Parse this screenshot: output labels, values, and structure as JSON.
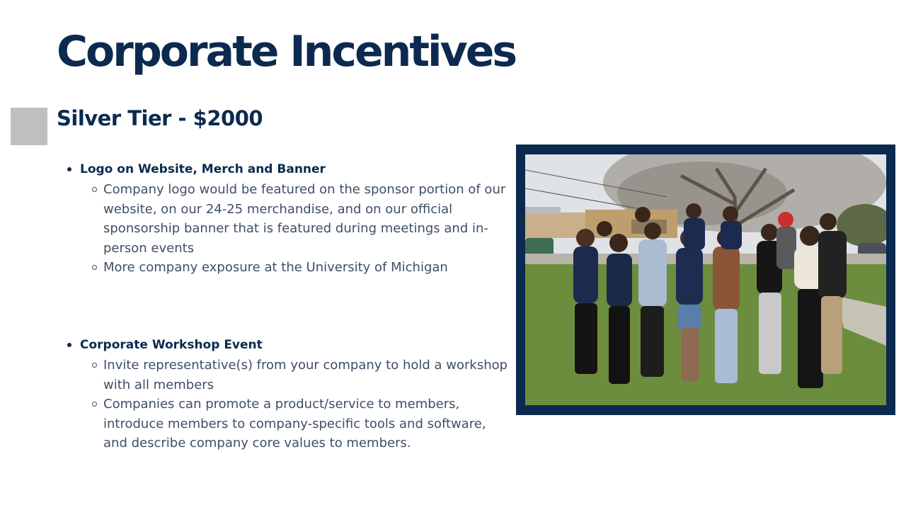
{
  "slide": {
    "title": "Corporate Incentives",
    "tier": "Silver Tier - $2000"
  },
  "benefits": [
    {
      "title": "Logo on Website, Merch and Banner",
      "items": [
        "Company logo would be featured on the sponsor portion of our website, on our 24-25 merchandise, and on our official sponsorship banner that is featured during meetings and in-person events",
        "More company exposure at the University of Michigan"
      ]
    },
    {
      "title": "Corporate Workshop Event",
      "items": [
        "Invite representative(s) from your company to hold a workshop with all members",
        "Companies can promote a product/service to members, introduce members to company-specific tools and software, and describe company core values to members."
      ]
    }
  ],
  "colors": {
    "heading": "#0c2a4f",
    "body_text": "#3e4f66",
    "tier_square": "#bfbfbf",
    "photo_frame": "#0c2a4f"
  }
}
